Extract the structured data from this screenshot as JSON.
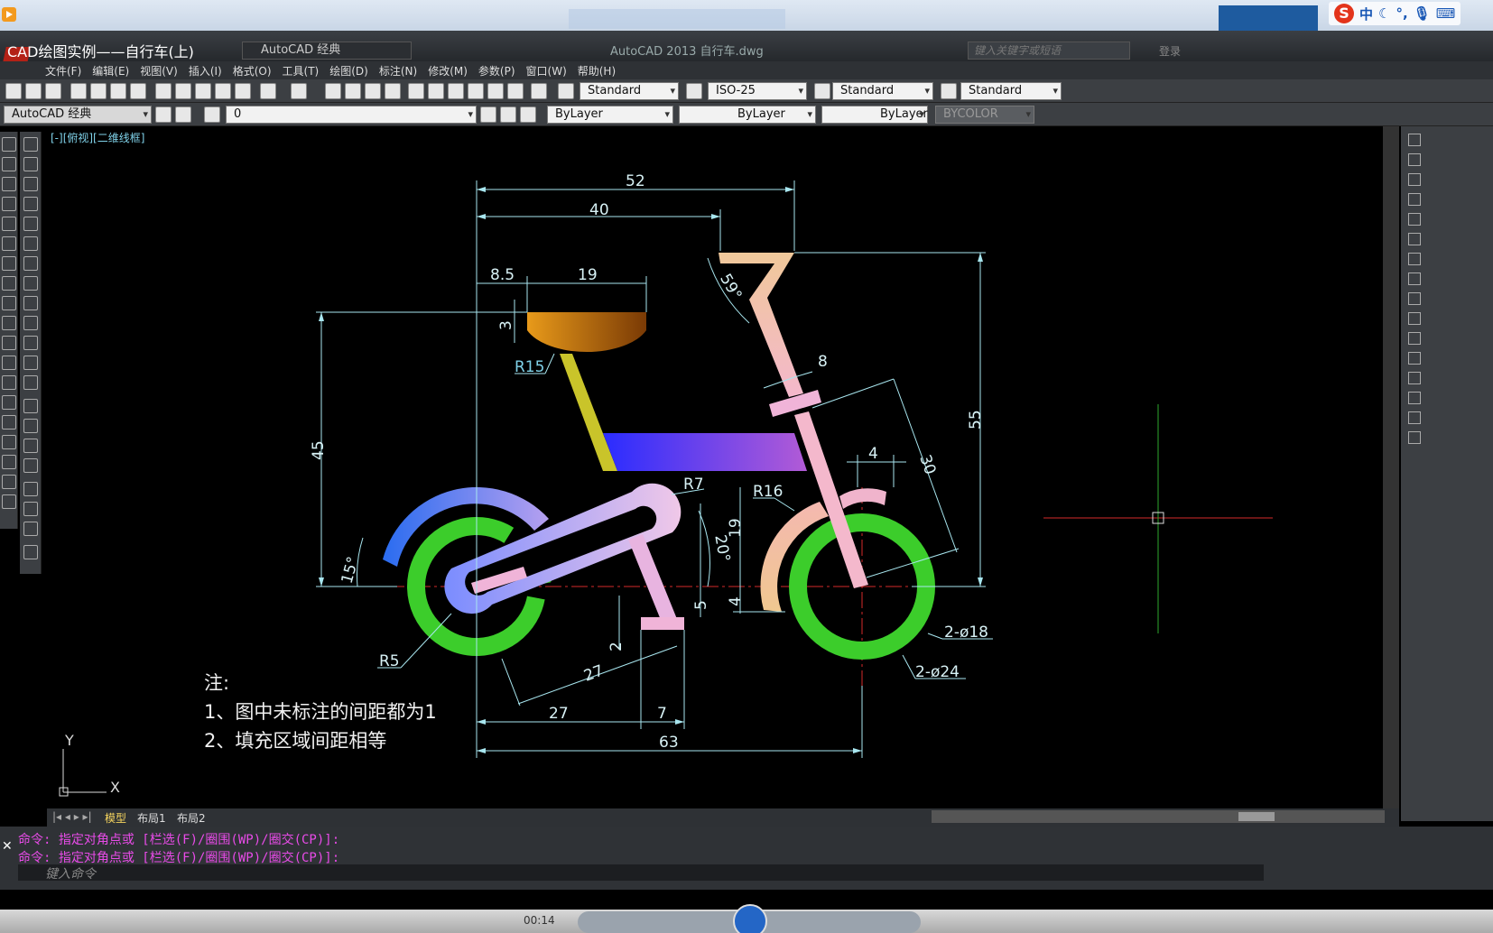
{
  "window": {
    "video_title": "CAD绘图实例——自行车(上)",
    "workspace": "AutoCAD 经典",
    "app_title": "AutoCAD 2013     自行车.dwg",
    "search_placeholder": "键入关键字或短语",
    "login_label": "登录"
  },
  "ime": {
    "logo": "S",
    "lang": "中"
  },
  "menu": [
    "文件(F)",
    "编辑(E)",
    "视图(V)",
    "插入(I)",
    "格式(O)",
    "工具(T)",
    "绘图(D)",
    "标注(N)",
    "修改(M)",
    "参数(P)",
    "窗口(W)",
    "帮助(H)"
  ],
  "styles_toolbar": {
    "text_style": "Standard",
    "dim_style": "ISO-25",
    "table_style": "Standard",
    "mleader_style": "Standard"
  },
  "layers_toolbar": {
    "workspace": "AutoCAD 经典",
    "layer": "0",
    "color": "ByLayer",
    "linetype": "ByLayer",
    "lineweight": "ByLayer",
    "plotstyle": "BYCOLOR"
  },
  "viewport_label": "[-][俯视][二维线框]",
  "drawing": {
    "dims": {
      "d52": "52",
      "d40": "40",
      "d8_5": "8.5",
      "d19_top": "19",
      "d3": "3",
      "r15": "R15",
      "d45": "45",
      "d59": "59°",
      "d8": "8",
      "d55": "55",
      "d4_top": "4",
      "d30": "30",
      "r7": "R7",
      "r16": "R16",
      "d20": "20°",
      "d19_mid": "19",
      "d5": "5",
      "d4_mid": "4",
      "d15": "15°",
      "d2": "2",
      "d27_slant": "27",
      "r5": "R5",
      "d18": "2-ø18",
      "d24": "2-ø24",
      "d27": "27",
      "d7": "7",
      "d63": "63"
    },
    "notes": {
      "title": "注:",
      "line1": "1、图中未标注的间距都为1",
      "line2": "2、填充区域间距相等"
    },
    "ucs": {
      "x": "X",
      "y": "Y"
    }
  },
  "tabs": [
    "模型",
    "布局1",
    "布局2"
  ],
  "command_history": [
    "命令: 指定对角点或 [栏选(F)/圈围(WP)/圈交(CP)]:",
    "命令: 指定对角点或 [栏选(F)/圈围(WP)/圈交(CP)]:"
  ],
  "command_placeholder": "键入命令",
  "player": {
    "time": "00:14"
  },
  "colors": {
    "wheel": "#3ccd2b",
    "dim_line": "#a8e6ef",
    "seat_from": "#e89a1a",
    "seat_to": "#7a3a05",
    "frame": "#f4b6cc",
    "tank_from": "#2a2cff",
    "tank_to": "#b25bd6",
    "command_text": "#e84be8"
  }
}
